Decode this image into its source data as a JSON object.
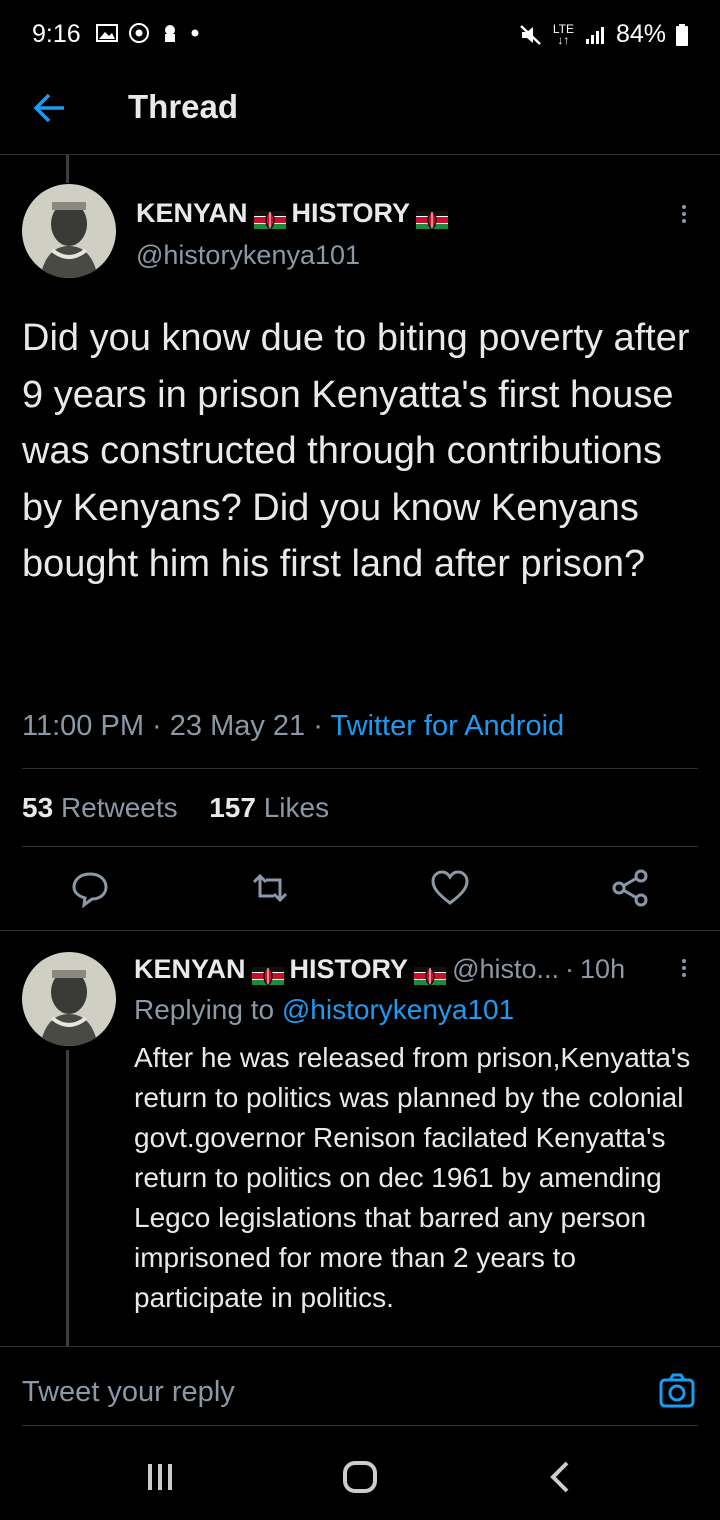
{
  "status_bar": {
    "time": "9:16",
    "network_top": "LTE",
    "network_bottom": "↓↑",
    "battery": "84%"
  },
  "header": {
    "title": "Thread"
  },
  "main_tweet": {
    "display_name_part1": "KENYAN",
    "display_name_part2": "HISTORY",
    "handle": "@historykenya101",
    "text": "Did you know due to biting poverty after 9 years in prison Kenyatta's first house was constructed through contributions by Kenyans? Did you know Kenyans bought him his first land after prison?",
    "time": "11:00 PM",
    "date": "23 May 21",
    "source": "Twitter for Android",
    "retweet_count": "53",
    "retweet_label": "Retweets",
    "like_count": "157",
    "like_label": "Likes"
  },
  "reply_tweet": {
    "display_name_part1": "KENYAN",
    "display_name_part2": "HISTORY",
    "handle": "@histo...",
    "age": "10h",
    "replying_prefix": "Replying to",
    "replying_handle": "@historykenya101",
    "text": "After he was released from prison,Kenyatta's return to politics was planned by the colonial govt.governor Renison facilated Kenyatta's return to politics on dec 1961 by amending Legco legislations that barred any person imprisoned for more than 2 years to participate in politics."
  },
  "reply_bar": {
    "placeholder": "Tweet your reply"
  },
  "colors": {
    "accent": "#1d9bf0",
    "background": "#000000",
    "muted": "#8b98a5"
  }
}
